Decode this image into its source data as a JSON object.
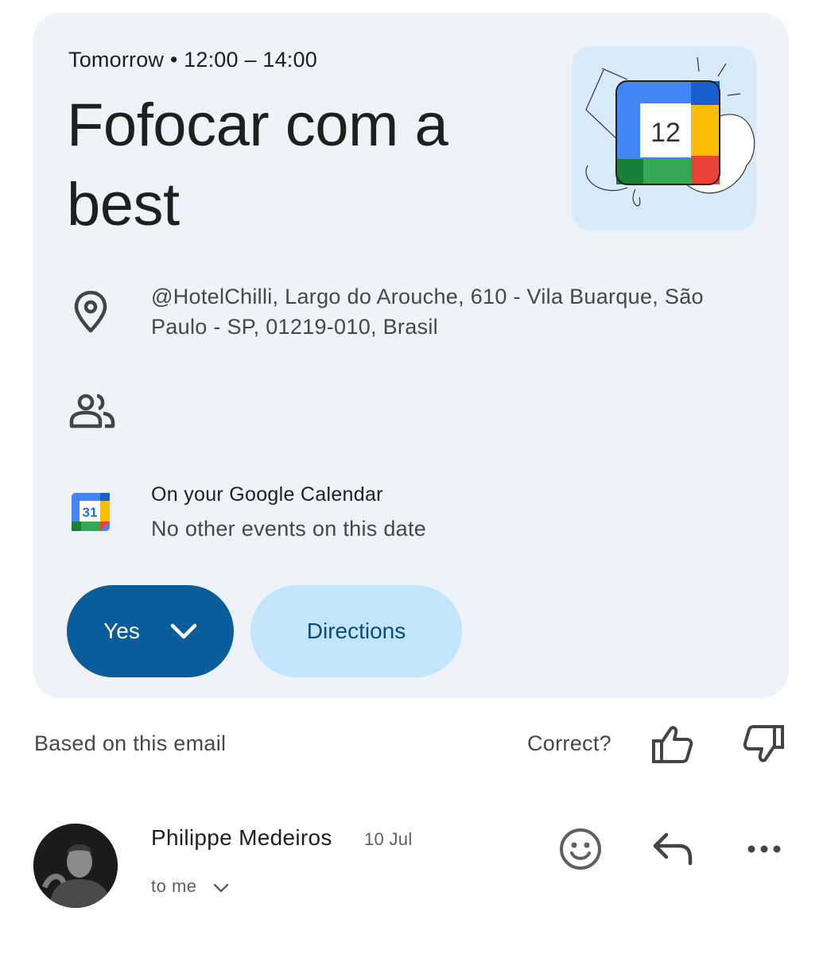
{
  "event": {
    "time_line": "Tomorrow • 12:00 – 14:00",
    "title": "Fofocar com a best",
    "illustration_number": "12",
    "address": "@HotelChilli, Largo do Arouche, 610 - Vila Buarque, São Paulo - SP, 01219-010, Brasil",
    "calendar_title": "On your Google Calendar",
    "calendar_subtitle": "No other events on this date",
    "calendar_icon_number": "31",
    "yes_label": "Yes",
    "directions_label": "Directions"
  },
  "feedback": {
    "based_label": "Based on this email",
    "correct_label": "Correct?"
  },
  "email": {
    "sender": "Philippe Medeiros",
    "date": "10 Jul",
    "recipient": "to me"
  },
  "colors": {
    "card_bg": "#eef2f9",
    "primary_button": "#0b5c9a",
    "secondary_button": "#c3e5fb",
    "secondary_text": "#0b4c7c"
  },
  "icons": [
    "location-pin-icon",
    "people-icon",
    "google-calendar-icon",
    "chevron-down-icon",
    "thumbs-up-icon",
    "thumbs-down-icon",
    "emoji-icon",
    "reply-icon",
    "more-icon"
  ]
}
